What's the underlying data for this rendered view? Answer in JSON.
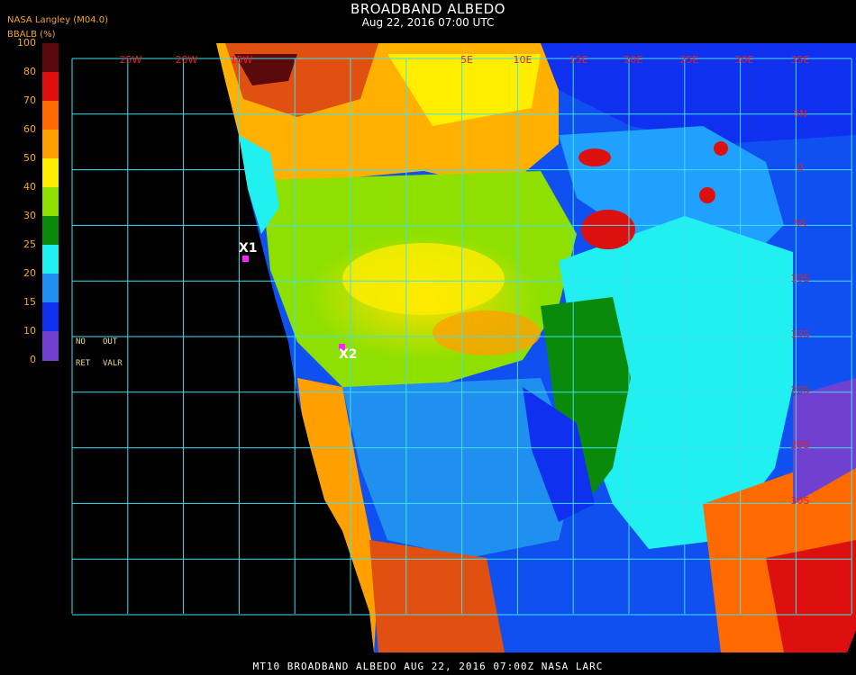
{
  "header": {
    "title": "BROADBAND ALBEDO",
    "subtitle": "Aug 22, 2016 07:00 UTC",
    "provider": "NASA Langley (M04.0)",
    "colorbar_label": "BBALB (%)"
  },
  "colorbar": {
    "ticks": [
      "100",
      "80",
      "70",
      "60",
      "50",
      "40",
      "30",
      "25",
      "20",
      "15",
      "10",
      "0"
    ],
    "colors": [
      "#5a0a0a",
      "#dd1010",
      "#ff6a00",
      "#ffa000",
      "#ffee00",
      "#8ee000",
      "#0a8a0a",
      "#20f0f0",
      "#2090f0",
      "#1030f0",
      "#7040d0"
    ]
  },
  "legend_notes": {
    "no": "NO",
    "out": "OUT",
    "ret": "RET",
    "valr": "VALR"
  },
  "grid": {
    "lon_labels": [
      "25W",
      "20W",
      "15W",
      "5E",
      "10E",
      "15E",
      "20E",
      "25E",
      "30E",
      "35E"
    ],
    "lat_labels": [
      "5N",
      "0",
      "5S",
      "10S",
      "15S",
      "20S",
      "25S",
      "30S"
    ]
  },
  "markers": [
    {
      "label": "X1",
      "color": "#ff20ff"
    },
    {
      "label": "X2",
      "color": "#ff20ff"
    }
  ],
  "footer": "MT10  BROADBAND ALBEDO   AUG 22, 2016 07:00Z   NASA LARC"
}
